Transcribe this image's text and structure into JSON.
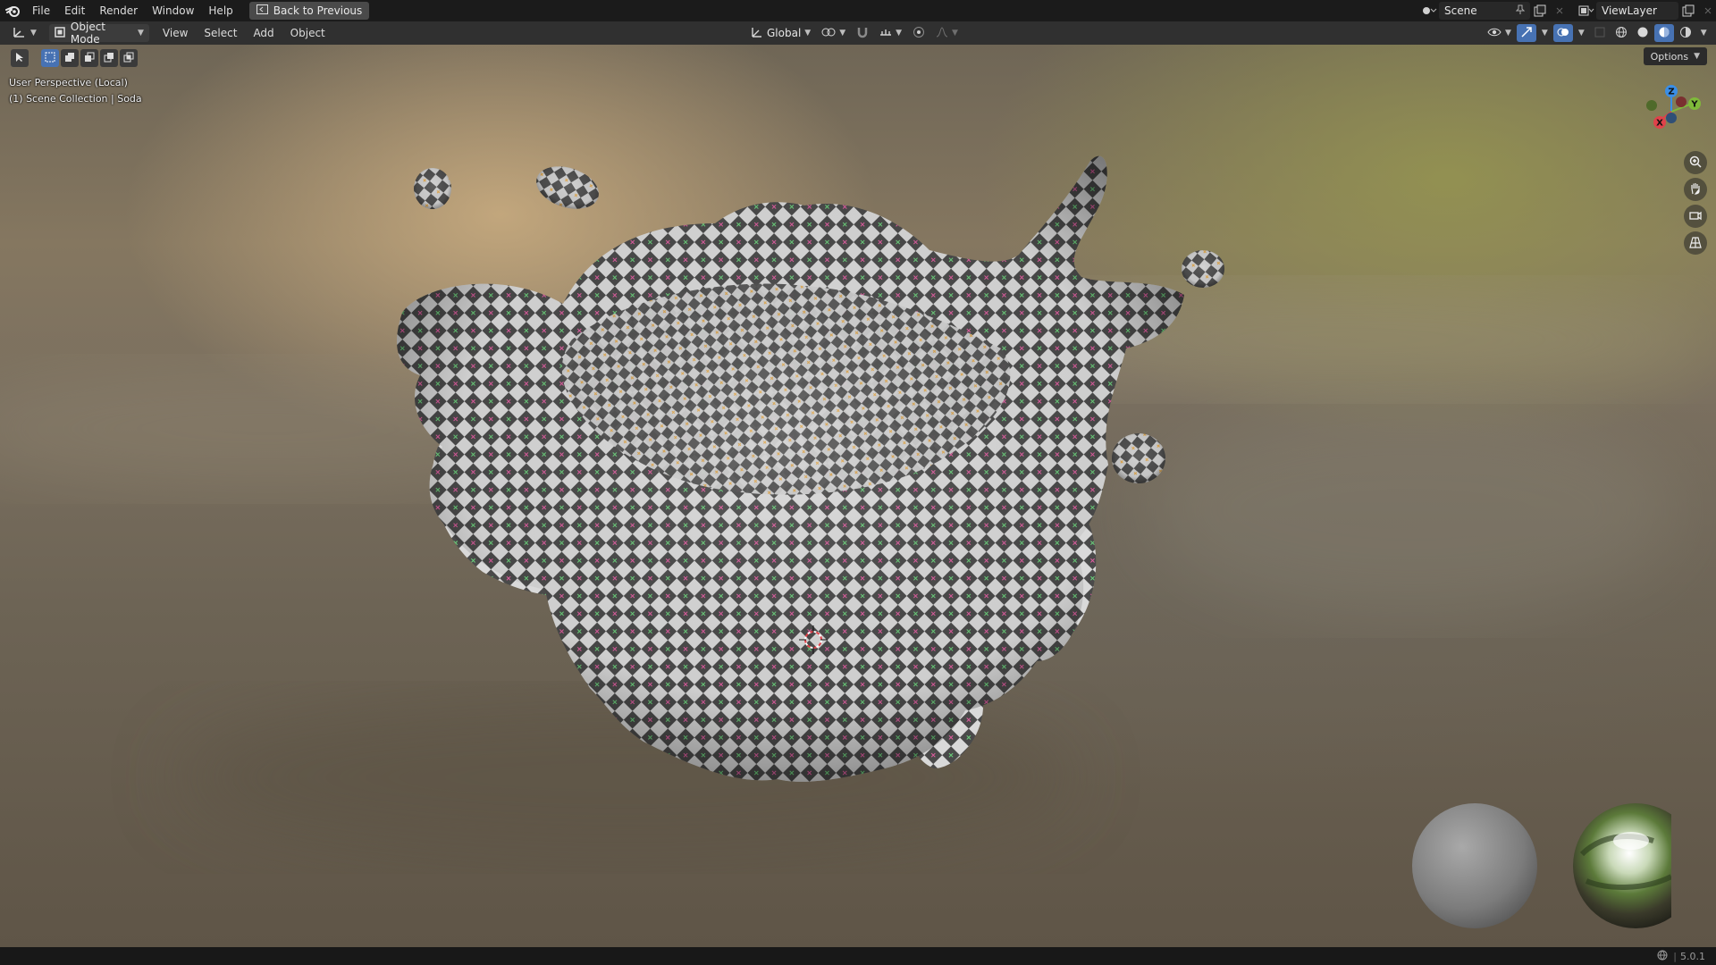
{
  "topbar": {
    "menus": [
      "File",
      "Edit",
      "Render",
      "Window",
      "Help"
    ],
    "back_label": "Back to Previous",
    "scene_label": "Scene",
    "viewlayer_label": "ViewLayer"
  },
  "header": {
    "mode_label": "Object Mode",
    "menus": [
      "View",
      "Select",
      "Add",
      "Object"
    ],
    "transform_orientation": "Global"
  },
  "viewport": {
    "perspective_label": "User Perspective (Local)",
    "collection_label": "(1) Scene Collection | Soda",
    "options_label": "Options",
    "gizmo": {
      "x": "X",
      "y": "Y",
      "z": "Z"
    },
    "colors": {
      "x_axis": "#e0424a",
      "y_axis": "#7fba3a",
      "z_axis": "#3a8ee6",
      "accent": "#4772b3"
    }
  },
  "statusbar": {
    "version": "5.0.1"
  }
}
